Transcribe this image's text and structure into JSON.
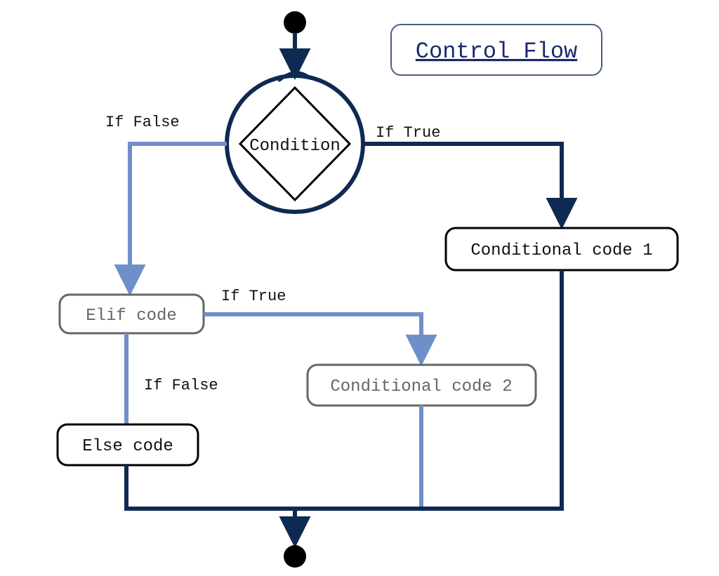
{
  "title": "Control Flow",
  "nodes": {
    "condition": "Condition",
    "cond_code_1": "Conditional code 1",
    "elif_code": "Elif code",
    "cond_code_2": "Conditional code 2",
    "else_code": "Else code"
  },
  "edges": {
    "if_true_1": "If True",
    "if_false_1": "If False",
    "if_true_2": "If True",
    "if_false_2": "If False"
  },
  "colors": {
    "dark_navy": "#0f2a52",
    "light_blue": "#6f8fc9",
    "black": "#000000",
    "grey": "#666666"
  },
  "diagram_type": "flowchart",
  "description": "If/elif/else control-flow diagram. Start dot feeds a Condition diamond (inside a circle). True -> Conditional code 1. False -> Elif code. Elif True -> Conditional code 2. Elif False -> Else code. All code branches merge to an end dot."
}
